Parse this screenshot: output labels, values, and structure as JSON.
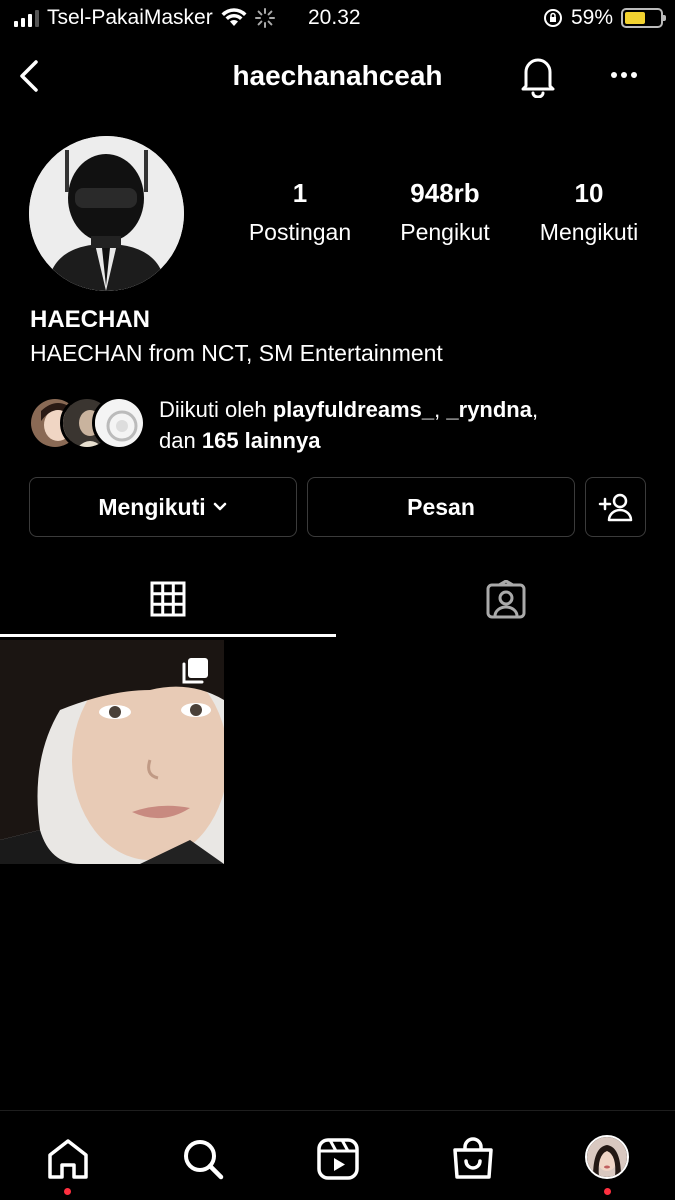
{
  "status_bar": {
    "carrier": "Tsel-PakaiMasker",
    "time": "20.32",
    "battery": "59%",
    "battery_level": 0.59
  },
  "header": {
    "username": "haechanahceah"
  },
  "profile": {
    "stats": [
      {
        "value": "1",
        "label": "Postingan"
      },
      {
        "value": "948rb",
        "label": "Pengikut"
      },
      {
        "value": "10",
        "label": "Mengikuti"
      }
    ],
    "name": "HAECHAN",
    "bio": "HAECHAN from NCT, SM Entertainment",
    "followed_by": {
      "prefix": "Diikuti oleh",
      "user1": "playfuldreams_",
      "sep": ",",
      "user2": "_ryndna",
      "sep2": ",",
      "and": "dan",
      "others": "165 lainnya"
    }
  },
  "actions": {
    "following_label": "Mengikuti",
    "message_label": "Pesan"
  },
  "tabs": [
    "grid-icon",
    "tagged-icon"
  ],
  "nav": [
    "home-icon",
    "search-icon",
    "reels-icon",
    "shop-icon",
    "profile-avatar"
  ],
  "colors": {
    "background": "#000000",
    "border": "#3b3b3b",
    "notification_dot": "#ff3040"
  }
}
